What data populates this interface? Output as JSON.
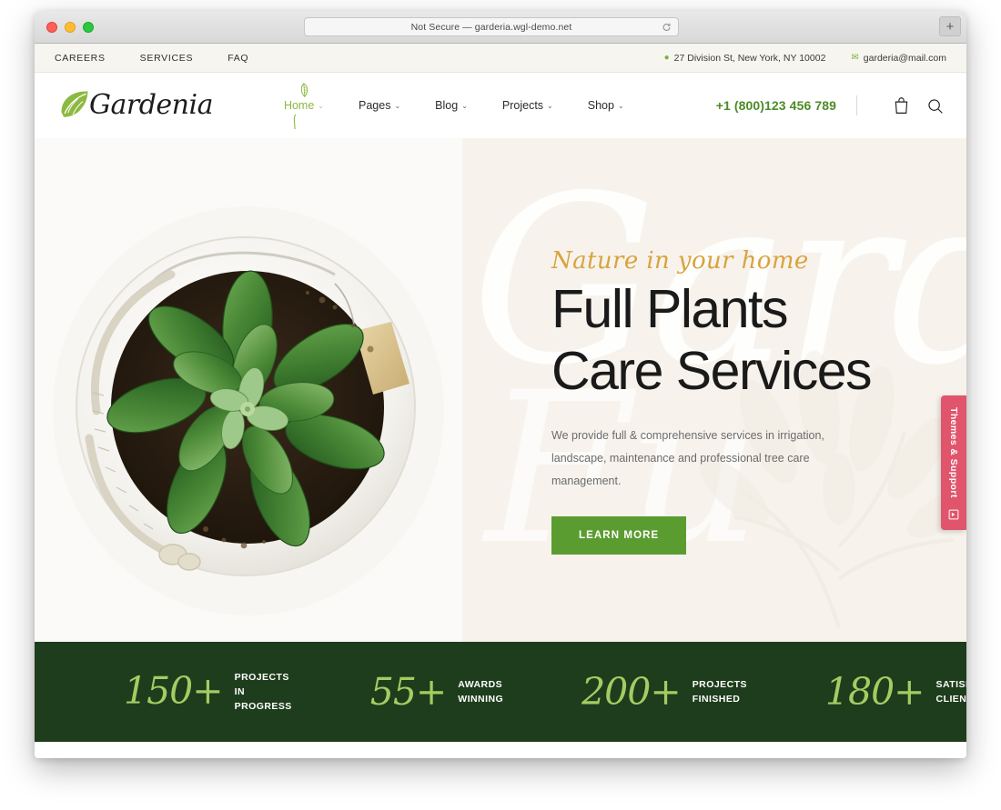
{
  "browser": {
    "url_text": "Not Secure — garderia.wgl-demo.net",
    "reload_icon": "reload-icon",
    "newtab_label": "+"
  },
  "topbar": {
    "links": [
      {
        "label": "CAREERS"
      },
      {
        "label": "SERVICES"
      },
      {
        "label": "FAQ"
      }
    ],
    "address": {
      "icon": "map-pin-icon",
      "text": "27 Division St, New York, NY 10002"
    },
    "email": {
      "icon": "envelope-icon",
      "text": "garderia@mail.com"
    }
  },
  "header": {
    "logo": {
      "icon": "leaf-logo-icon",
      "text": "Gardenia"
    },
    "nav": [
      {
        "label": "Home",
        "caret": "⌄",
        "active": true
      },
      {
        "label": "Pages",
        "caret": "⌄",
        "active": false
      },
      {
        "label": "Blog",
        "caret": "⌄",
        "active": false
      },
      {
        "label": "Projects",
        "caret": "⌄",
        "active": false
      },
      {
        "label": "Shop",
        "caret": "⌄",
        "active": false
      }
    ],
    "phone": "+1 (800)123 456 789",
    "cart_icon": "shopping-bag-icon",
    "search_icon": "search-icon"
  },
  "hero": {
    "watermark_text": "Garde",
    "watermark_text2": "Fu",
    "photo_alt": "succulent-plant-in-white-pot",
    "script_heading": "Nature in your home",
    "title_line1": "Full Plants",
    "title_line2": "Care Services",
    "description": "We provide full & comprehensive services in irrigation, landscape, maintenance and professional tree care management.",
    "cta_label": "LEARN MORE",
    "cta_color": "#5b9c31"
  },
  "support_tab": {
    "label": "Themes & Support",
    "icon": "book-icon",
    "color": "#e0556c"
  },
  "stats": {
    "accent_color": "#a4cc62",
    "background": "#1e3d1c",
    "items": [
      {
        "number": "150+",
        "label_line1": "PROJECTS IN",
        "label_line2": "PROGRESS"
      },
      {
        "number": "55+",
        "label_line1": "AWARDS",
        "label_line2": "WINNING"
      },
      {
        "number": "200+",
        "label_line1": "PROJECTS",
        "label_line2": "FINISHED"
      },
      {
        "number": "180+",
        "label_line1": "SATISFIED",
        "label_line2": "CLIENTS"
      }
    ]
  }
}
